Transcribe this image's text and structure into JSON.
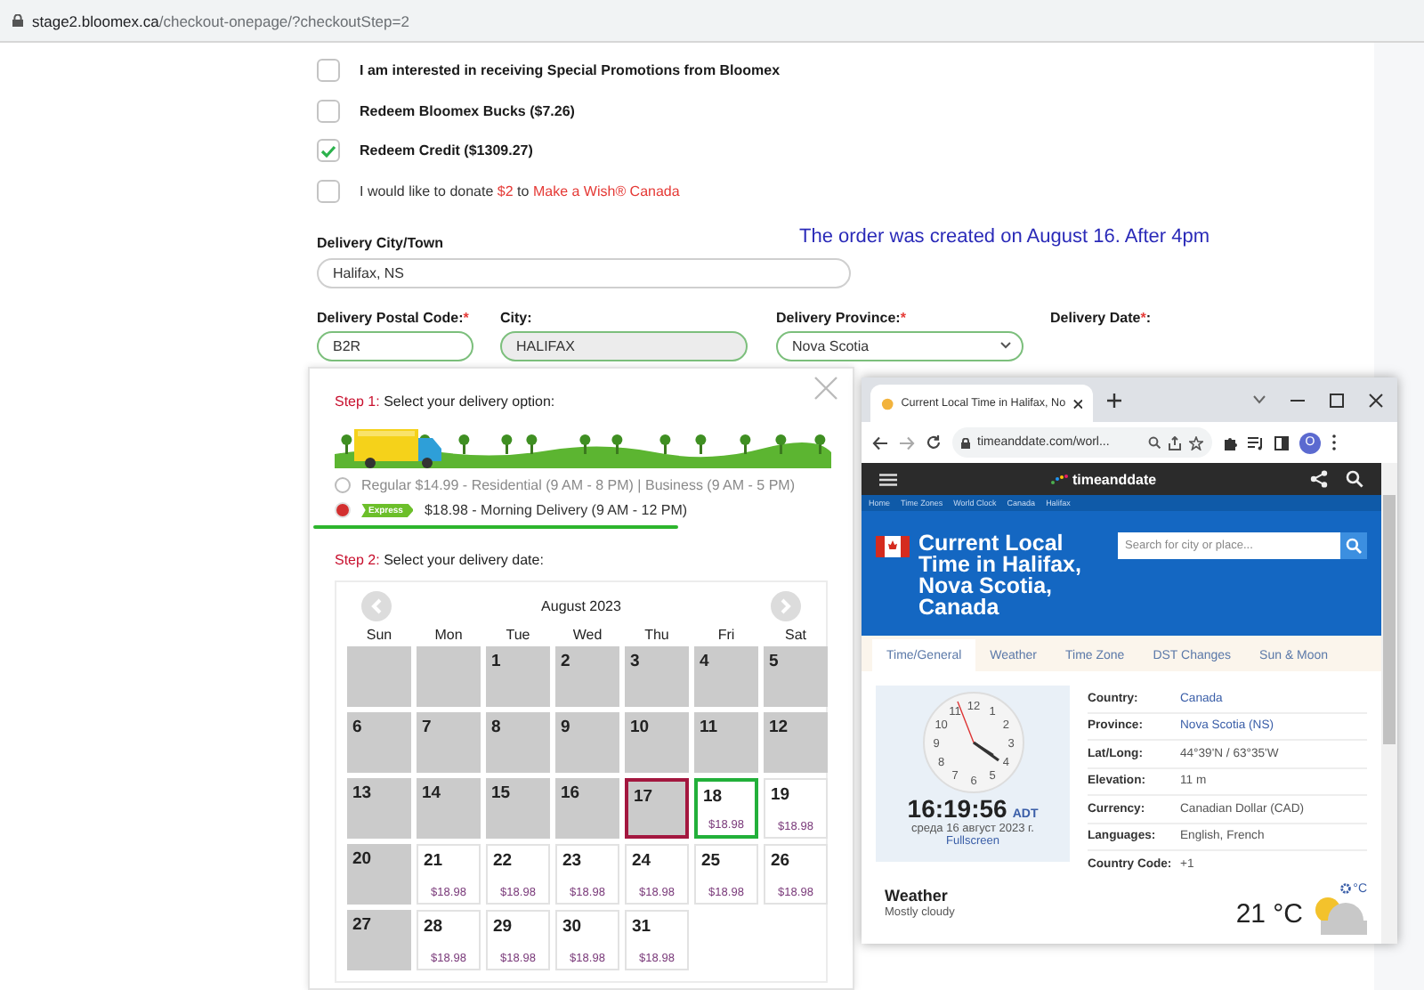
{
  "address_bar": {
    "host": "stage2.bloomex.ca",
    "path": "/checkout-onepage/?checkoutStep=2"
  },
  "options": [
    {
      "kind": "plain",
      "label": "I am interested in receiving Special Promotions from Bloomex",
      "checked": false
    },
    {
      "kind": "plain",
      "label": "Redeem Bloomex Bucks ($7.26)",
      "checked": false
    },
    {
      "kind": "plain",
      "label": "Redeem Credit ($1309.27)",
      "checked": true
    },
    {
      "kind": "donation",
      "label": "I would like to donate",
      "amount": "$2",
      "connector": "to",
      "link": "Make a Wish® Canada",
      "checked": false
    }
  ],
  "note": "The order was created on August 16. After 4pm",
  "city_town": {
    "label": "Delivery City/Town",
    "value": "Halifax, NS"
  },
  "fields": [
    {
      "kind": "text",
      "label": "Delivery Postal Code:",
      "required_mark": "*",
      "value": "B2R"
    },
    {
      "kind": "readonly",
      "label": "City:",
      "value": "HALIFAX"
    },
    {
      "kind": "select",
      "label": "Delivery Province:",
      "required_mark": "*",
      "value": "Nova Scotia"
    },
    {
      "kind": "heading",
      "label": "Delivery Date",
      "required_mark": "*",
      "suffix": ":"
    }
  ],
  "delivery": {
    "step1": {
      "step": "Step 1:",
      "text": "Select your delivery option:"
    },
    "options": [
      {
        "label": "Regular $14.99 - Residential (9 AM - 8 PM) | Business (9 AM - 5 PM)",
        "selected": false
      },
      {
        "label": "$18.98 - Morning Delivery (9 AM - 12 PM)",
        "badge": "Express",
        "selected": true
      }
    ],
    "step2": {
      "step": "Step 2:",
      "text": "Select your delivery date:"
    },
    "calendar": {
      "month": "August 2023",
      "weekdays": [
        "Sun",
        "Mon",
        "Tue",
        "Wed",
        "Thu",
        "Fri",
        "Sat"
      ],
      "weeks": [
        [
          {
            "kind": "blank"
          },
          {
            "kind": "blank"
          },
          {
            "kind": "unavailable",
            "day": "1"
          },
          {
            "kind": "unavailable",
            "day": "2"
          },
          {
            "kind": "unavailable",
            "day": "3"
          },
          {
            "kind": "unavailable",
            "day": "4"
          },
          {
            "kind": "unavailable",
            "day": "5"
          }
        ],
        [
          {
            "kind": "unavailable",
            "day": "6"
          },
          {
            "kind": "unavailable",
            "day": "7"
          },
          {
            "kind": "unavailable",
            "day": "8"
          },
          {
            "kind": "unavailable",
            "day": "9"
          },
          {
            "kind": "unavailable",
            "day": "10"
          },
          {
            "kind": "unavailable",
            "day": "11"
          },
          {
            "kind": "unavailable",
            "day": "12"
          }
        ],
        [
          {
            "kind": "unavailable",
            "day": "13"
          },
          {
            "kind": "unavailable",
            "day": "14"
          },
          {
            "kind": "unavailable",
            "day": "15"
          },
          {
            "kind": "unavailable",
            "day": "16"
          },
          {
            "kind": "unavailable",
            "day": "17",
            "color": "#a3173f"
          },
          {
            "kind": "available",
            "day": "18",
            "price": "$18.98",
            "color": "#22b03a"
          },
          {
            "kind": "available",
            "day": "19",
            "price": "$18.98"
          }
        ],
        [
          {
            "kind": "unavailable",
            "day": "20"
          },
          {
            "kind": "available",
            "day": "21",
            "price": "$18.98"
          },
          {
            "kind": "available",
            "day": "22",
            "price": "$18.98"
          },
          {
            "kind": "available",
            "day": "23",
            "price": "$18.98"
          },
          {
            "kind": "available",
            "day": "24",
            "price": "$18.98"
          },
          {
            "kind": "available",
            "day": "25",
            "price": "$18.98"
          },
          {
            "kind": "available",
            "day": "26",
            "price": "$18.98"
          }
        ],
        [
          {
            "kind": "unavailable",
            "day": "27"
          },
          {
            "kind": "available",
            "day": "28",
            "price": "$18.98"
          },
          {
            "kind": "available",
            "day": "29",
            "price": "$18.98"
          },
          {
            "kind": "available",
            "day": "30",
            "price": "$18.98"
          },
          {
            "kind": "available",
            "day": "31",
            "price": "$18.98"
          },
          {
            "kind": "empty"
          },
          {
            "kind": "empty"
          }
        ]
      ]
    }
  },
  "browser": {
    "tab_title": "Current Local Time in Halifax, No",
    "url": "timeanddate.com/worl...",
    "avatar_letter": "O",
    "site": {
      "logo": "timeanddate",
      "breadcrumbs": [
        "Home",
        "Time Zones",
        "World Clock",
        "Canada",
        "Halifax"
      ],
      "heading": "Current Local Time in Halifax, Nova Scotia, Canada",
      "search_placeholder": "Search for city or place...",
      "tabs": [
        {
          "label": "Time/General",
          "selected": true
        },
        {
          "label": "Weather",
          "selected": false
        },
        {
          "label": "Time Zone",
          "selected": false
        },
        {
          "label": "DST Changes",
          "selected": false
        },
        {
          "label": "Sun & Moon",
          "selected": false
        }
      ],
      "clock": {
        "numbers": [
          "11",
          "12",
          "1",
          "10",
          "2",
          "9",
          "3",
          "8",
          "4",
          "7",
          "6",
          "5"
        ],
        "time": "16:19:56",
        "zone": "ADT",
        "date": "среда 16 август 2023 г.",
        "fullscreen": "Fullscreen"
      },
      "facts": [
        {
          "kind": "link",
          "label": "Country:",
          "value": "Canada"
        },
        {
          "kind": "link",
          "label": "Province:",
          "value": "Nova Scotia (NS)"
        },
        {
          "kind": "text",
          "label": "Lat/Long:",
          "value": "44°39'N / 63°35'W"
        },
        {
          "kind": "text",
          "label": "Elevation:",
          "value": "11 m"
        },
        {
          "kind": "text",
          "label": "Currency:",
          "value": "Canadian Dollar (CAD)"
        },
        {
          "kind": "text",
          "label": "Languages:",
          "value": "English, French"
        },
        {
          "kind": "text",
          "label": "Country Code:",
          "value": "+1"
        }
      ],
      "weather": {
        "title": "Weather",
        "condition": "Mostly cloudy",
        "temperature": "21 °C",
        "unit": "°C"
      }
    }
  }
}
